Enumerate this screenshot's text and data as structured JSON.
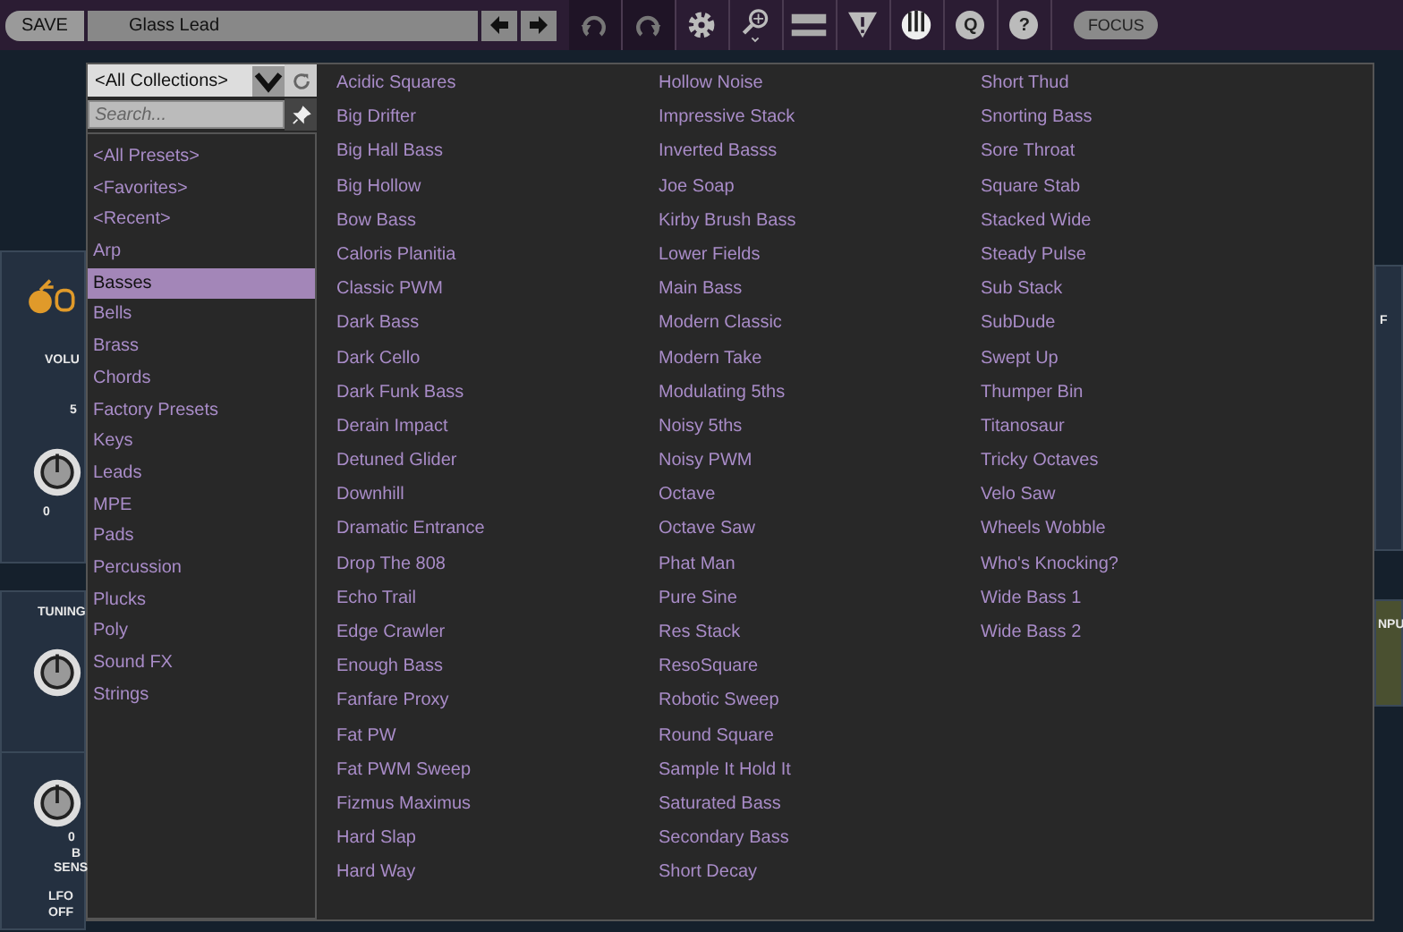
{
  "toolbar": {
    "save_label": "SAVE",
    "preset_name": "Glass Lead",
    "focus_label": "FOCUS",
    "q_label": "Q",
    "help_label": "?"
  },
  "browser": {
    "collection": "<All Collections>",
    "search": {
      "placeholder": "Search..."
    },
    "categories": [
      {
        "label": "<All Presets>",
        "selected": false
      },
      {
        "label": "<Favorites>",
        "selected": false
      },
      {
        "label": "<Recent>",
        "selected": false
      },
      {
        "label": "Arp",
        "selected": false
      },
      {
        "label": "Basses",
        "selected": true
      },
      {
        "label": "Bells",
        "selected": false
      },
      {
        "label": "Brass",
        "selected": false
      },
      {
        "label": "Chords",
        "selected": false
      },
      {
        "label": "Factory Presets",
        "selected": false
      },
      {
        "label": "Keys",
        "selected": false
      },
      {
        "label": "Leads",
        "selected": false
      },
      {
        "label": "MPE",
        "selected": false
      },
      {
        "label": "Pads",
        "selected": false
      },
      {
        "label": "Percussion",
        "selected": false
      },
      {
        "label": "Plucks",
        "selected": false
      },
      {
        "label": "Poly",
        "selected": false
      },
      {
        "label": "Sound FX",
        "selected": false
      },
      {
        "label": "Strings",
        "selected": false
      }
    ],
    "presets": [
      "Acidic Squares",
      "Big Drifter",
      "Big Hall Bass",
      "Big Hollow",
      "Bow Bass",
      "Caloris Planitia",
      "Classic PWM",
      "Dark Bass",
      "Dark Cello",
      "Dark Funk Bass",
      "Derain Impact",
      "Detuned Glider",
      "Downhill",
      "Dramatic Entrance",
      "Drop The 808",
      "Echo Trail",
      "Edge Crawler",
      "Enough Bass",
      "Fanfare Proxy",
      "Fat PW",
      "Fat PWM Sweep",
      "Fizmus Maximus",
      "Hard Slap",
      "Hard Way",
      "Hollow Noise",
      "Impressive Stack",
      "Inverted Basss",
      "Joe Soap",
      "Kirby Brush Bass",
      "Lower Fields",
      "Main Bass",
      "Modern Classic",
      "Modern Take",
      "Modulating 5ths",
      "Noisy 5ths",
      "Noisy PWM",
      "Octave",
      "Octave Saw",
      "Phat Man",
      "Pure Sine",
      "Res Stack",
      "ResoSquare",
      "Robotic Sweep",
      "Round Square",
      "Sample It Hold It",
      "Saturated Bass",
      "Secondary Bass",
      "Short Decay",
      "Short Thud",
      "Snorting Bass",
      "Sore Throat",
      "Square Stab",
      "Stacked Wide",
      "Steady Pulse",
      "Sub Stack",
      "SubDude",
      "Swept Up",
      "Thumper Bin",
      "Titanosaur",
      "Tricky Octaves",
      "Velo Saw",
      "Wheels Wobble",
      "Who's Knocking?",
      "Wide Bass 1",
      "Wide Bass 2"
    ]
  },
  "synth_panel": {
    "labels": [
      "VOLU",
      "5",
      "0",
      "TUNING",
      "0",
      "B",
      "SENS",
      "LFO",
      "OFF",
      "F",
      "NPU"
    ]
  }
}
